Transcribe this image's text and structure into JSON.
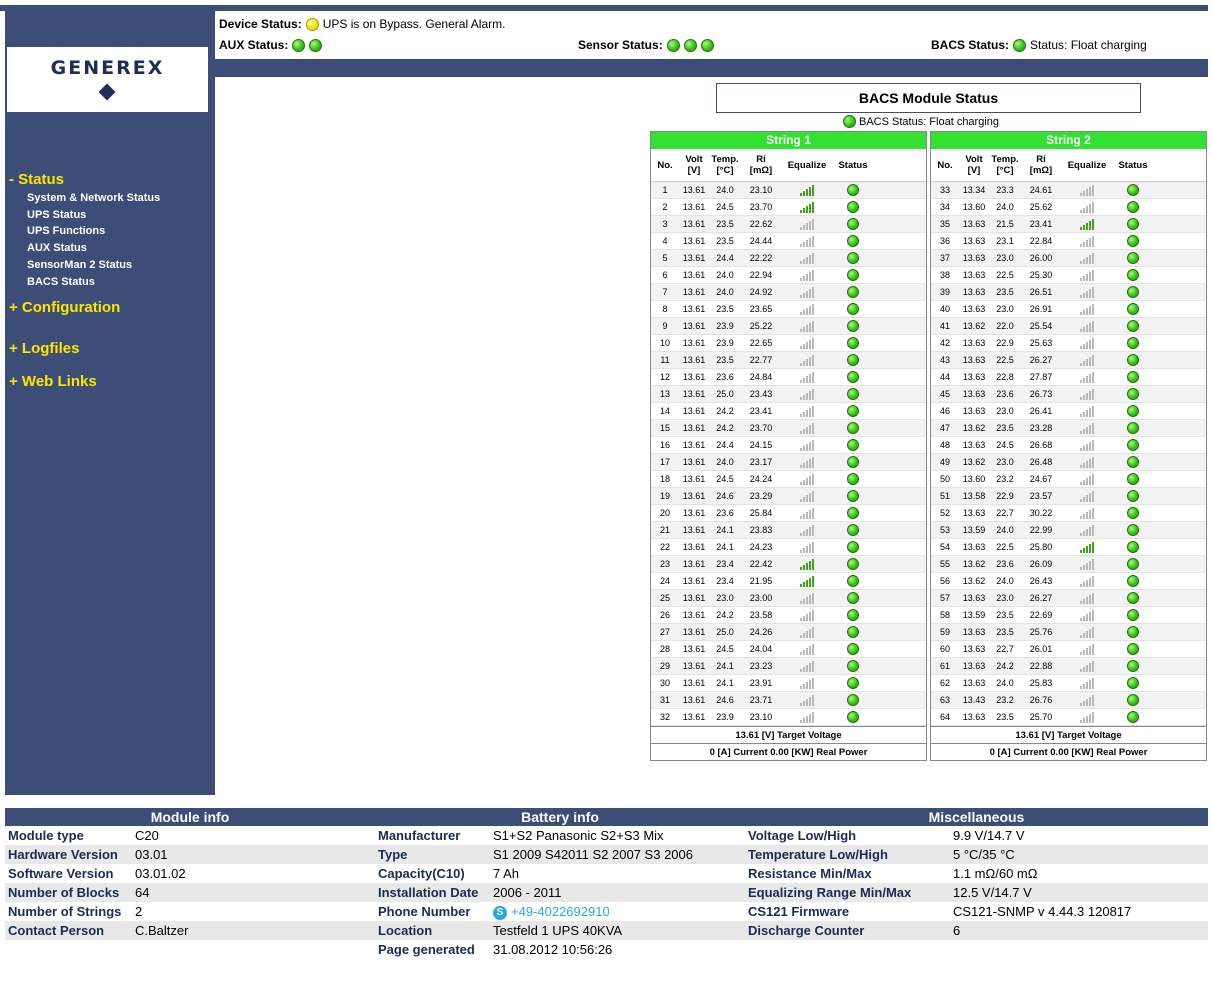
{
  "logo": {
    "text": "GENEREX"
  },
  "sidebar": {
    "sections": [
      {
        "label": "- Status",
        "items": [
          "System & Network Status",
          "UPS Status",
          "UPS Functions",
          "AUX Status",
          "SensorMan 2 Status",
          "BACS Status"
        ]
      },
      {
        "label": "+ Configuration"
      },
      {
        "label": "+ Logfiles"
      },
      {
        "label": "+ Web Links"
      }
    ]
  },
  "header": {
    "device_label": "Device Status:",
    "device_text": "UPS is on Bypass. General Alarm.",
    "aux_label": "AUX Status:",
    "sensor_label": "Sensor Status:",
    "bacs_label": "BACS Status:",
    "bacs_text": "Status: Float charging",
    "colors": {
      "green": "#35c219",
      "yellow": "#f9e300",
      "band": "#3c4d78"
    }
  },
  "bacs": {
    "title": "BACS Module Status",
    "status_text": "BACS Status: Float charging",
    "columns": {
      "no": "No.",
      "volt": "Volt",
      "volt_unit": "[V]",
      "temp": "Temp.",
      "temp_unit": "[°C]",
      "ri": "Ri",
      "ri_unit": "[mΩ]",
      "equalize": "Equalize",
      "status": "Status"
    },
    "strings": [
      {
        "name": "String 1",
        "target_voltage": "13.61 [V] Target Voltage",
        "power_line": "0 [A] Current   0.00 [KW] Real Power",
        "rows": [
          [
            "1",
            "13.61",
            "24.0",
            "23.10",
            1
          ],
          [
            "2",
            "13.61",
            "24.5",
            "23.70",
            1
          ],
          [
            "3",
            "13.61",
            "23.5",
            "22.62",
            0
          ],
          [
            "4",
            "13.61",
            "23.5",
            "24.44",
            0
          ],
          [
            "5",
            "13.61",
            "24.4",
            "22.22",
            0
          ],
          [
            "6",
            "13.61",
            "24.0",
            "22.94",
            0
          ],
          [
            "7",
            "13.61",
            "24.0",
            "24.92",
            0
          ],
          [
            "8",
            "13.61",
            "23.5",
            "23.65",
            0
          ],
          [
            "9",
            "13.61",
            "23.9",
            "25.22",
            0
          ],
          [
            "10",
            "13.61",
            "23.9",
            "22.65",
            0
          ],
          [
            "11",
            "13.61",
            "23.5",
            "22.77",
            0
          ],
          [
            "12",
            "13.61",
            "23.6",
            "24.84",
            0
          ],
          [
            "13",
            "13.61",
            "25.0",
            "23.43",
            0
          ],
          [
            "14",
            "13.61",
            "24.2",
            "23.41",
            0
          ],
          [
            "15",
            "13.61",
            "24.2",
            "23.70",
            0
          ],
          [
            "16",
            "13.61",
            "24.4",
            "24.15",
            0
          ],
          [
            "17",
            "13.61",
            "24.0",
            "23.17",
            0
          ],
          [
            "18",
            "13.61",
            "24.5",
            "24.24",
            0
          ],
          [
            "19",
            "13.61",
            "24.6",
            "23.29",
            0
          ],
          [
            "20",
            "13.61",
            "23.6",
            "25.84",
            0
          ],
          [
            "21",
            "13.61",
            "24.1",
            "23.83",
            0
          ],
          [
            "22",
            "13.61",
            "24.1",
            "24.23",
            0
          ],
          [
            "23",
            "13.61",
            "23.4",
            "22.42",
            1
          ],
          [
            "24",
            "13.61",
            "23.4",
            "21.95",
            1
          ],
          [
            "25",
            "13.61",
            "23.0",
            "23.00",
            0
          ],
          [
            "26",
            "13.61",
            "24.2",
            "23.58",
            0
          ],
          [
            "27",
            "13.61",
            "25.0",
            "24.26",
            0
          ],
          [
            "28",
            "13.61",
            "24.5",
            "24.04",
            0
          ],
          [
            "29",
            "13.61",
            "24.1",
            "23.23",
            0
          ],
          [
            "30",
            "13.61",
            "24.1",
            "23.91",
            0
          ],
          [
            "31",
            "13.61",
            "24.6",
            "23.71",
            0
          ],
          [
            "32",
            "13.61",
            "23.9",
            "23.10",
            0
          ]
        ]
      },
      {
        "name": "String 2",
        "target_voltage": "13.61 [V] Target Voltage",
        "power_line": "0 [A] Current   0.00 [KW] Real Power",
        "rows": [
          [
            "33",
            "13.34",
            "23.3",
            "24.61",
            0
          ],
          [
            "34",
            "13.60",
            "24.0",
            "25.62",
            0
          ],
          [
            "35",
            "13.63",
            "21.5",
            "23.41",
            1
          ],
          [
            "36",
            "13.63",
            "23.1",
            "22.84",
            0
          ],
          [
            "37",
            "13.63",
            "23.0",
            "26.00",
            0
          ],
          [
            "38",
            "13.63",
            "22.5",
            "25.30",
            0
          ],
          [
            "39",
            "13.63",
            "23.5",
            "26.51",
            0
          ],
          [
            "40",
            "13.63",
            "23.0",
            "26.91",
            0
          ],
          [
            "41",
            "13.62",
            "22.0",
            "25.54",
            0
          ],
          [
            "42",
            "13.63",
            "22.9",
            "25.63",
            0
          ],
          [
            "43",
            "13.63",
            "22.5",
            "26.27",
            0
          ],
          [
            "44",
            "13.63",
            "22.8",
            "27.87",
            0
          ],
          [
            "45",
            "13.63",
            "23.6",
            "26.73",
            0
          ],
          [
            "46",
            "13.63",
            "23.0",
            "26.41",
            0
          ],
          [
            "47",
            "13.62",
            "23.5",
            "23.28",
            0
          ],
          [
            "48",
            "13.63",
            "24.5",
            "26.68",
            0
          ],
          [
            "49",
            "13.62",
            "23.0",
            "26.48",
            0
          ],
          [
            "50",
            "13.60",
            "23.2",
            "24.67",
            0
          ],
          [
            "51",
            "13.58",
            "22.9",
            "23.57",
            0
          ],
          [
            "52",
            "13.63",
            "22.7",
            "30.22",
            0
          ],
          [
            "53",
            "13.59",
            "24.0",
            "22.99",
            0
          ],
          [
            "54",
            "13.63",
            "22.5",
            "25.80",
            1
          ],
          [
            "55",
            "13.62",
            "23.6",
            "26.09",
            0
          ],
          [
            "56",
            "13.62",
            "24.0",
            "26.43",
            0
          ],
          [
            "57",
            "13.63",
            "23.0",
            "26.27",
            0
          ],
          [
            "58",
            "13.59",
            "23.5",
            "22.69",
            0
          ],
          [
            "59",
            "13.63",
            "23.5",
            "25.76",
            0
          ],
          [
            "60",
            "13.63",
            "22.7",
            "26.01",
            0
          ],
          [
            "61",
            "13.63",
            "24.2",
            "22.88",
            0
          ],
          [
            "62",
            "13.63",
            "24.0",
            "25.83",
            0
          ],
          [
            "63",
            "13.43",
            "23.2",
            "26.76",
            0
          ],
          [
            "64",
            "13.63",
            "23.5",
            "25.70",
            0
          ]
        ]
      }
    ]
  },
  "info": {
    "headers": [
      "Module info",
      "Battery info",
      "Miscellaneous"
    ],
    "module": [
      [
        "Module type",
        "C20"
      ],
      [
        "Hardware Version",
        "03.01"
      ],
      [
        "Software Version",
        "03.01.02"
      ],
      [
        "Number of Blocks",
        "64"
      ],
      [
        "Number of Strings",
        "2"
      ],
      [
        "Contact Person",
        "C.Baltzer"
      ]
    ],
    "battery": [
      [
        "Manufacturer",
        "S1+S2 Panasonic S2+S3 Mix"
      ],
      [
        "Type",
        "S1 2009 S42011 S2 2007 S3 2006"
      ],
      [
        "Capacity(C10)",
        "7 Ah"
      ],
      [
        "Installation Date",
        "2006 - 2011"
      ],
      [
        "Phone Number",
        "+49-4022692910"
      ],
      [
        "Location",
        "Testfeld 1 UPS 40KVA"
      ],
      [
        "Page generated",
        "31.08.2012 10:56:26"
      ]
    ],
    "misc": [
      [
        "Voltage Low/High",
        "9.9 V/14.7 V"
      ],
      [
        "Temperature Low/High",
        "5 °C/35 °C"
      ],
      [
        "Resistance Min/Max",
        "1.1 mΩ/60 mΩ"
      ],
      [
        "Equalizing Range Min/Max",
        "12.5 V/14.7 V"
      ],
      [
        "CS121 Firmware",
        "CS121-SNMP v 4.44.3 120817"
      ],
      [
        "Discharge Counter",
        "6"
      ]
    ]
  }
}
